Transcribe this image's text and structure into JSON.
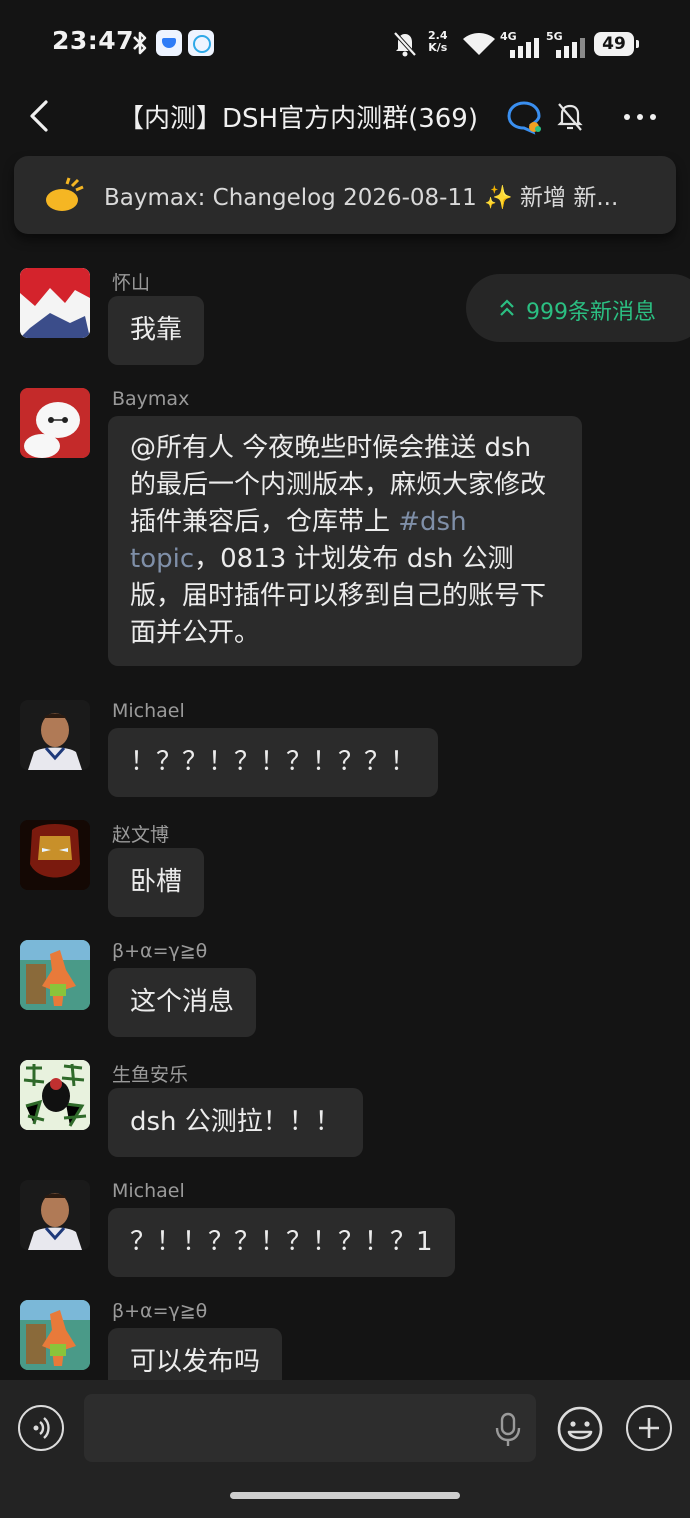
{
  "status_bar": {
    "time": "23:47",
    "net_speed_value": "2.4",
    "net_speed_unit": "K/s",
    "signal1_label": "4G",
    "signal2_label": "5G",
    "battery": "49",
    "icons": [
      "bluetooth-icon",
      "app-notification-icon",
      "qq-notification-icon",
      "mute-notification-icon",
      "wifi-icon",
      "signal-icon"
    ]
  },
  "header": {
    "title": "【内测】DSH官方内测群(369)",
    "icons": [
      "back-icon",
      "group-badge-icon",
      "mute-bell-icon",
      "more-icon"
    ]
  },
  "pinned": {
    "text": "Baymax:  Changelog 2026-08-11 ✨ 新增 新...",
    "icon": "announcement-horn-icon"
  },
  "new_messages": {
    "label": "999条新消息",
    "icon": "double-chevron-up-icon"
  },
  "messages": [
    {
      "sender": "怀山",
      "text": "我靠"
    },
    {
      "sender": "Baymax",
      "text_before": "@所有人 今夜晚些时候会推送 dsh 的最后一个内测版本，麻烦大家修改插件兼容后，仓库带上 ",
      "hashtag": "#dsh topic",
      "text_after": "，0813 计划发布 dsh 公测版，届时插件可以移到自己的账号下面并公开。"
    },
    {
      "sender": "Michael",
      "text": "！？？！？！？！？？！"
    },
    {
      "sender": "赵文博",
      "text": "卧槽"
    },
    {
      "sender": "β+α=γ≧θ",
      "text": "这个消息"
    },
    {
      "sender": "生鱼安乐",
      "text": "dsh 公测拉！！！"
    },
    {
      "sender": "Michael",
      "text": "？！！？？！？！？！？1"
    },
    {
      "sender": "β+α=γ≧θ",
      "text": "可以发布吗"
    }
  ],
  "input": {
    "value": "",
    "placeholder": "",
    "icons": [
      "voice-icon",
      "mic-icon",
      "emoji-icon",
      "plus-icon"
    ]
  },
  "colors": {
    "background": "#141414",
    "bubble": "#2b2b2b",
    "accent_green": "#2bbf82",
    "hashtag": "#7f8fa8"
  }
}
